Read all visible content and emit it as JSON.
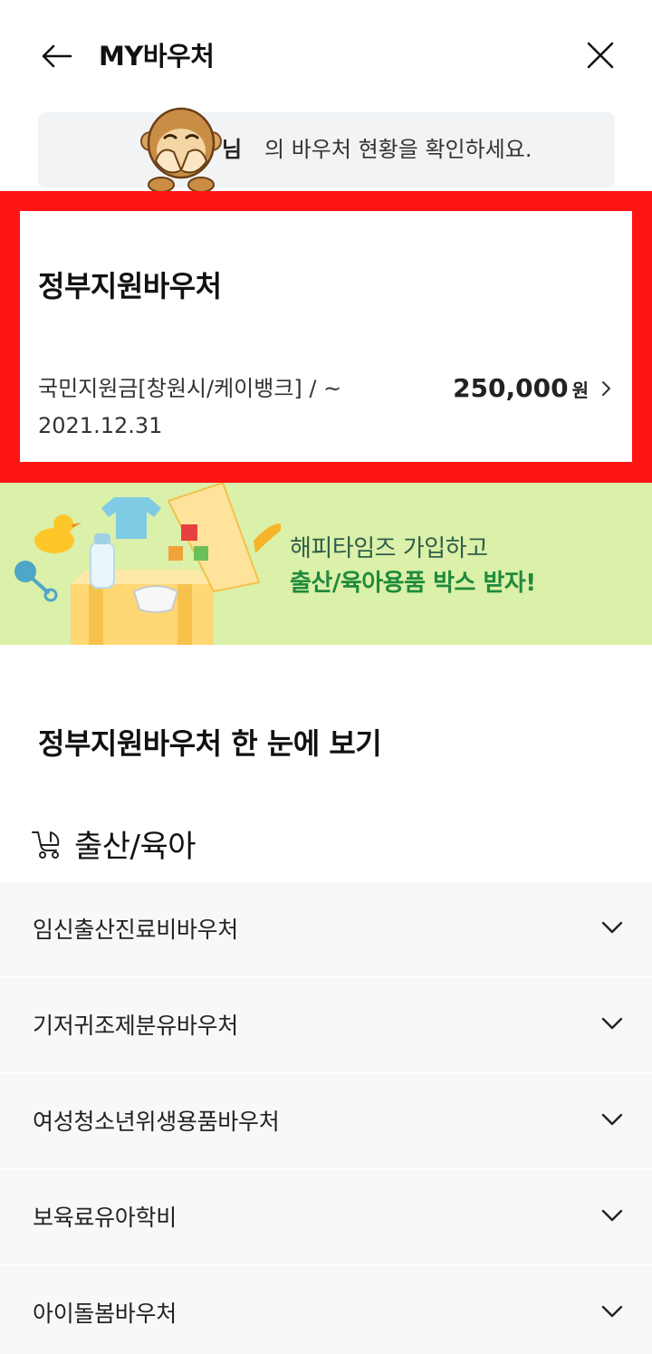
{
  "header": {
    "title": "MY바우처",
    "back_icon": "arrow-left-icon",
    "close_icon": "close-icon"
  },
  "notice": {
    "name_prefix": "님",
    "text": "의 바우처 현황을 확인하세요."
  },
  "voucher_card": {
    "title": "정부지원바우처",
    "description": "국민지원금[창원시/케이뱅크] / ~ 2021.12.31",
    "amount": "250,000",
    "unit": "원",
    "highlight_color": "#ff1414"
  },
  "banner": {
    "line1": "해피타임즈 가입하고",
    "line2": "출산/육아용품 박스 받자!",
    "background": "#dbf0a8"
  },
  "section": {
    "heading": "정부지원바우처 한 눈에 보기",
    "category": {
      "icon": "stroller-icon",
      "label": "출산/육아"
    }
  },
  "accordion": [
    {
      "label": "임신출산진료비바우처"
    },
    {
      "label": "기저귀조제분유바우처"
    },
    {
      "label": "여성청소년위생용품바우처"
    },
    {
      "label": "보육료유아학비"
    },
    {
      "label": "아이돌봄바우처"
    }
  ]
}
